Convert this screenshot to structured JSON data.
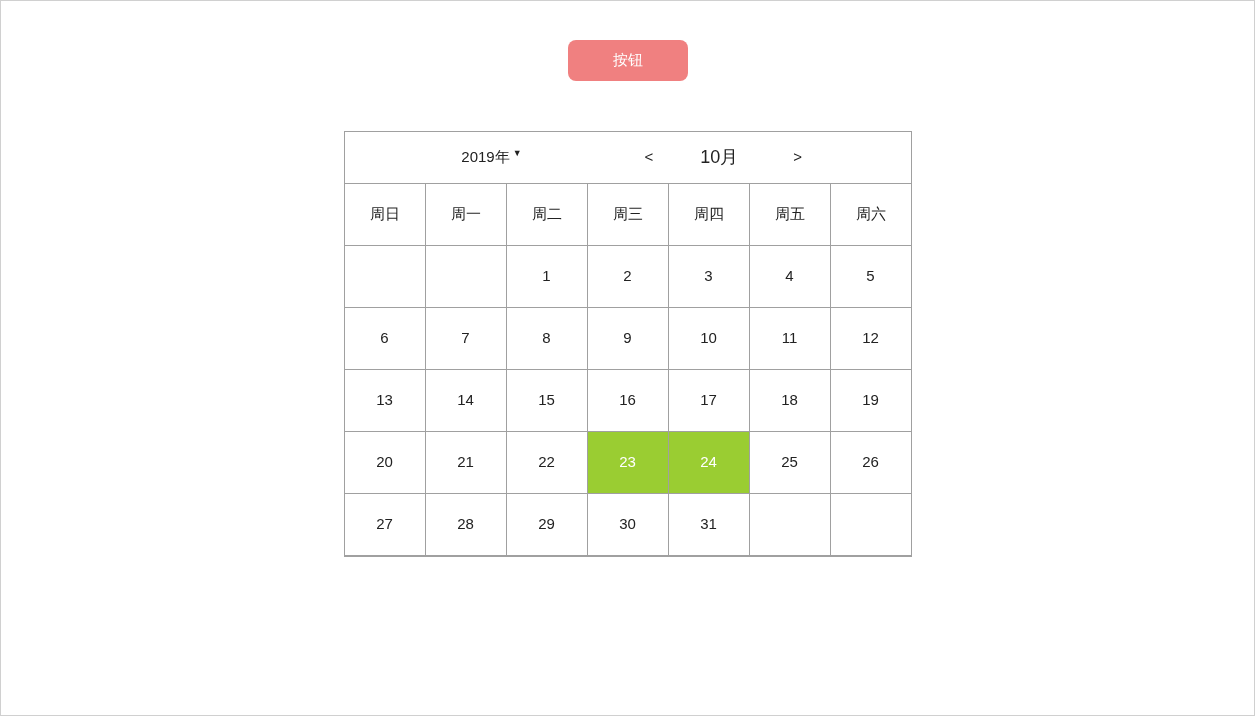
{
  "button": {
    "label": "按钮"
  },
  "calendar": {
    "year": "2019年",
    "year_caret": "▼",
    "prev": "<",
    "month": "10月",
    "next": ">",
    "weekdays": [
      "周日",
      "周一",
      "周二",
      "周三",
      "周四",
      "周五",
      "周六"
    ],
    "weeks": [
      [
        {
          "kind": "blank"
        },
        {
          "kind": "blank"
        },
        {
          "kind": "day",
          "day": "1",
          "selected": false
        },
        {
          "kind": "day",
          "day": "2",
          "selected": false
        },
        {
          "kind": "day",
          "day": "3",
          "selected": false
        },
        {
          "kind": "day",
          "day": "4",
          "selected": false
        },
        {
          "kind": "day",
          "day": "5",
          "selected": false
        }
      ],
      [
        {
          "kind": "day",
          "day": "6",
          "selected": false
        },
        {
          "kind": "day",
          "day": "7",
          "selected": false
        },
        {
          "kind": "day",
          "day": "8",
          "selected": false
        },
        {
          "kind": "day",
          "day": "9",
          "selected": false
        },
        {
          "kind": "day",
          "day": "10",
          "selected": false
        },
        {
          "kind": "day",
          "day": "11",
          "selected": false
        },
        {
          "kind": "day",
          "day": "12",
          "selected": false
        }
      ],
      [
        {
          "kind": "day",
          "day": "13",
          "selected": false
        },
        {
          "kind": "day",
          "day": "14",
          "selected": false
        },
        {
          "kind": "day",
          "day": "15",
          "selected": false
        },
        {
          "kind": "day",
          "day": "16",
          "selected": false
        },
        {
          "kind": "day",
          "day": "17",
          "selected": false
        },
        {
          "kind": "day",
          "day": "18",
          "selected": false
        },
        {
          "kind": "day",
          "day": "19",
          "selected": false
        }
      ],
      [
        {
          "kind": "day",
          "day": "20",
          "selected": false
        },
        {
          "kind": "day",
          "day": "21",
          "selected": false
        },
        {
          "kind": "day",
          "day": "22",
          "selected": false
        },
        {
          "kind": "day",
          "day": "23",
          "selected": true
        },
        {
          "kind": "day",
          "day": "24",
          "selected": true
        },
        {
          "kind": "day",
          "day": "25",
          "selected": false
        },
        {
          "kind": "day",
          "day": "26",
          "selected": false
        }
      ],
      [
        {
          "kind": "day",
          "day": "27",
          "selected": false
        },
        {
          "kind": "day",
          "day": "28",
          "selected": false
        },
        {
          "kind": "day",
          "day": "29",
          "selected": false
        },
        {
          "kind": "day",
          "day": "30",
          "selected": false
        },
        {
          "kind": "day",
          "day": "31",
          "selected": false
        },
        {
          "kind": "blank"
        },
        {
          "kind": "blank"
        }
      ]
    ]
  }
}
